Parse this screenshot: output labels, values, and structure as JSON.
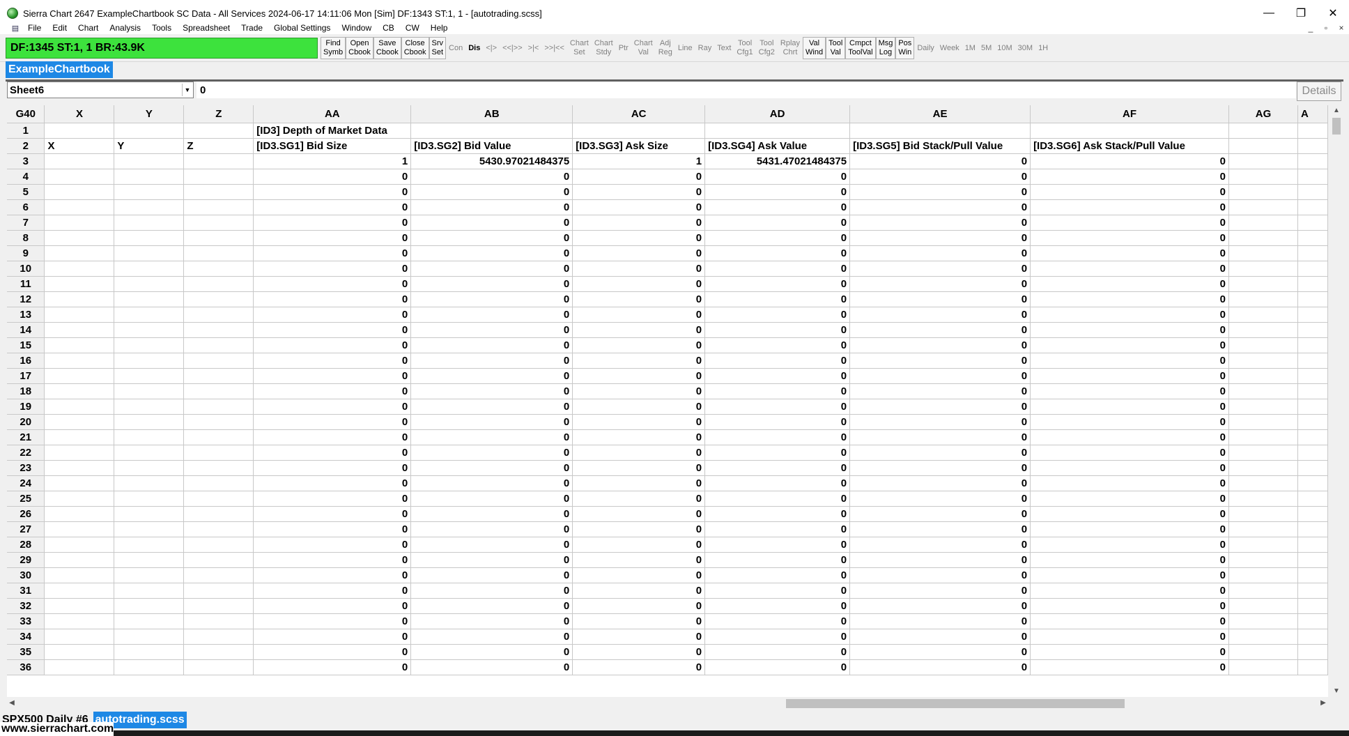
{
  "window": {
    "title": "Sierra Chart 2647 ExampleChartbook SC Data - All Services 2024-06-17  14:11:06 Mon [Sim] DF:1343  ST:1, 1 - [autotrading.scss]",
    "minimize": "—",
    "restore": "❐",
    "close": "✕"
  },
  "menu": {
    "items": [
      "File",
      "Edit",
      "Chart",
      "Analysis",
      "Tools",
      "Spreadsheet",
      "Trade",
      "Global Settings",
      "Window",
      "CB",
      "CW",
      "Help"
    ],
    "mdi_min": "_",
    "mdi_restore": "▫",
    "mdi_close": "×"
  },
  "status": {
    "text": "DF:1345  ST:1, 1  BR:43.9K"
  },
  "toolbar": {
    "buttons": [
      {
        "line1": "Find",
        "line2": "Symb",
        "style": "bordered"
      },
      {
        "line1": "Open",
        "line2": "Cbook",
        "style": "bordered"
      },
      {
        "line1": "Save",
        "line2": "Cbook",
        "style": "bordered"
      },
      {
        "line1": "Close",
        "line2": "Cbook",
        "style": "bordered"
      },
      {
        "line1": "Srv",
        "line2": "Set",
        "style": "bordered"
      },
      {
        "line1": "Con",
        "line2": "",
        "style": "dim"
      },
      {
        "line1": "Dis",
        "line2": "",
        "style": "bold"
      },
      {
        "line1": "<|>",
        "line2": "",
        "style": "dim"
      },
      {
        "line1": "<<|>>",
        "line2": "",
        "style": "dim"
      },
      {
        "line1": ">|<",
        "line2": "",
        "style": "dim"
      },
      {
        "line1": ">>|<<",
        "line2": "",
        "style": "dim"
      },
      {
        "line1": "Chart",
        "line2": "Set",
        "style": "dim"
      },
      {
        "line1": "Chart",
        "line2": "Stdy",
        "style": "dim"
      },
      {
        "line1": "Ptr",
        "line2": "",
        "style": "dim"
      },
      {
        "line1": "Chart",
        "line2": "Val",
        "style": "dim"
      },
      {
        "line1": "Adj",
        "line2": "Reg",
        "style": "dim"
      },
      {
        "line1": "Line",
        "line2": "",
        "style": "dim"
      },
      {
        "line1": "Ray",
        "line2": "",
        "style": "dim"
      },
      {
        "line1": "Text",
        "line2": "",
        "style": "dim"
      },
      {
        "line1": "Tool",
        "line2": "Cfg1",
        "style": "dim"
      },
      {
        "line1": "Tool",
        "line2": "Cfg2",
        "style": "dim"
      },
      {
        "line1": "Rplay",
        "line2": "Chrt",
        "style": "dim"
      },
      {
        "line1": "Val",
        "line2": "Wind",
        "style": "bordered"
      },
      {
        "line1": "Tool",
        "line2": "Val",
        "style": "bordered"
      },
      {
        "line1": "Cmpct",
        "line2": "ToolVal",
        "style": "bordered"
      },
      {
        "line1": "Msg",
        "line2": "Log",
        "style": "bordered"
      },
      {
        "line1": "Pos",
        "line2": "Win",
        "style": "bordered"
      },
      {
        "line1": "Daily",
        "line2": "",
        "style": "dim"
      },
      {
        "line1": "Week",
        "line2": "",
        "style": "dim"
      },
      {
        "line1": "1M",
        "line2": "",
        "style": "dim"
      },
      {
        "line1": "5M",
        "line2": "",
        "style": "dim"
      },
      {
        "line1": "10M",
        "line2": "",
        "style": "dim"
      },
      {
        "line1": "30M",
        "line2": "",
        "style": "dim"
      },
      {
        "line1": "1H",
        "line2": "",
        "style": "dim"
      }
    ]
  },
  "chartbook_tab": "ExampleChartbook",
  "sheet_selector": {
    "value": "Sheet6"
  },
  "formula_bar": {
    "value": "0"
  },
  "details_button": "Details",
  "spreadsheet": {
    "corner": "G40",
    "columns": [
      "X",
      "Y",
      "Z",
      "AA",
      "AB",
      "AC",
      "AD",
      "AE",
      "AF",
      "AG",
      "A"
    ],
    "row1": {
      "AA": "[ID3] Depth of Market Data"
    },
    "row2": [
      "X",
      "Y",
      "Z",
      "[ID3.SG1] Bid Size",
      "[ID3.SG2] Bid Value",
      "[ID3.SG3] Ask Size",
      "[ID3.SG4] Ask Value",
      "[ID3.SG5] Bid Stack/Pull Value",
      "[ID3.SG6] Ask Stack/Pull Value",
      "",
      ""
    ],
    "row3": [
      "1",
      "5430.97021484375",
      "1",
      "5431.47021484375",
      "0",
      "0"
    ],
    "zero_rows_start": 4,
    "zero_rows_end": 36,
    "zero_value": "0"
  },
  "bottom_tabs": {
    "chart": "SPX500  Daily #6",
    "spreadsheet": "autotrading.scss"
  },
  "watermark": "www.sierrachart.com",
  "colors": {
    "status_green": "#3de23d",
    "tab_blue": "#1e88e5"
  }
}
